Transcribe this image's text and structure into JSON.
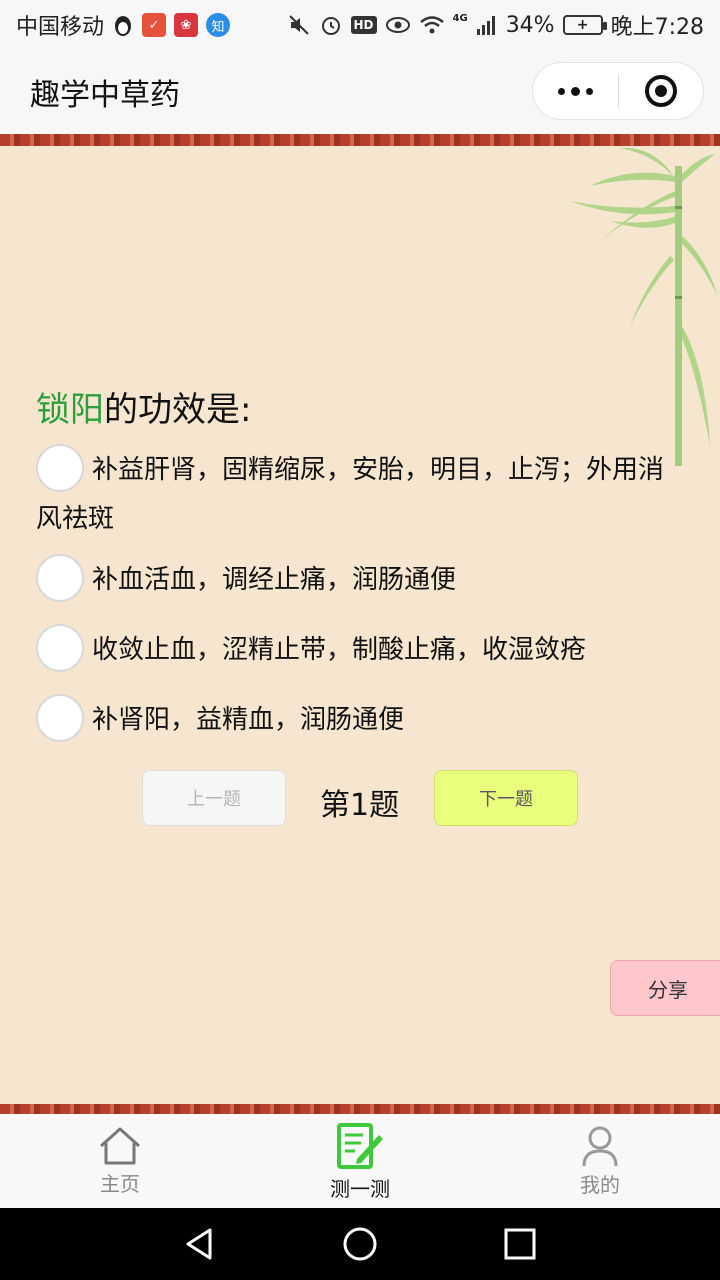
{
  "status_bar": {
    "carrier": "中国移动",
    "battery_percent": "34%",
    "time": "晚上7:28",
    "hd_label": "HD",
    "network_label": "4G",
    "app_badge_zhi": "知",
    "icons": [
      "penguin-icon",
      "weibo-icon",
      "huawei-icon",
      "zhihu-icon",
      "mute-icon",
      "alarm-icon",
      "eye-icon",
      "wifi-icon",
      "signal-icon",
      "battery-icon"
    ]
  },
  "title_bar": {
    "title": "趣学中草药"
  },
  "quiz": {
    "herb_name": "锁阳",
    "question_suffix": "的功效是:",
    "options": [
      {
        "label": "补益肝肾，固精缩尿，安胎，明目，止泻；外用消风祛斑"
      },
      {
        "label": "补血活血，调经止痛，润肠通便"
      },
      {
        "label": "收敛止血，涩精止带，制酸止痛，收湿敛疮"
      },
      {
        "label": "补肾阳，益精血，润肠通便"
      }
    ],
    "prev_label": "上一题",
    "question_number": "第1题",
    "next_label": "下一题",
    "share_label": "分享"
  },
  "tab_bar": {
    "tabs": [
      {
        "label": "主页",
        "icon": "home-icon",
        "active": false
      },
      {
        "label": "测一测",
        "icon": "quiz-edit-icon",
        "active": true
      },
      {
        "label": "我的",
        "icon": "user-icon",
        "active": false
      }
    ]
  },
  "colors": {
    "background": "#f7e6cf",
    "herb_green": "#2e9e3c",
    "next_button": "#eaff7c",
    "share_button": "#ffc6cc",
    "active_tab_icon": "#3ec93a"
  }
}
